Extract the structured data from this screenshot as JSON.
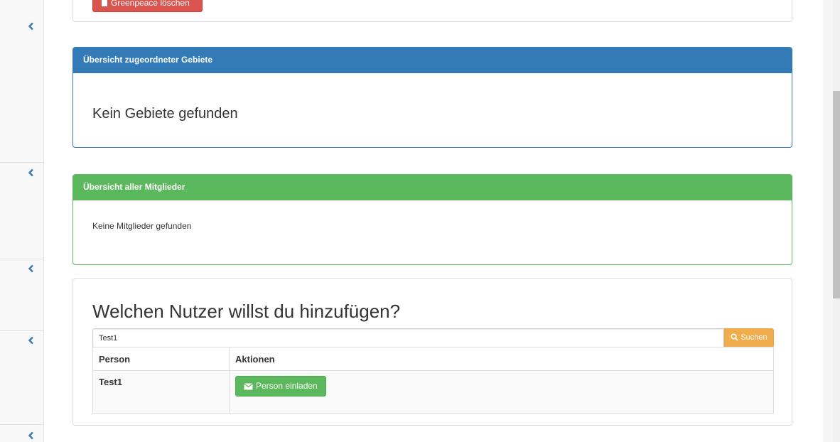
{
  "sidebar": {
    "chevrons": [
      "chevron-left-icon",
      "chevron-left-icon",
      "chevron-left-icon",
      "chevron-left-icon",
      "chevron-left-icon"
    ]
  },
  "greenpeace_panel": {
    "delete_button": "Greenpeace löschen"
  },
  "areas_panel": {
    "heading": "Übersicht zugeordneter Gebiete",
    "empty_text": "Kein Gebiete gefunden"
  },
  "members_panel": {
    "heading": "Übersicht aller Mitglieder",
    "empty_text": "Keine Mitglieder gefunden"
  },
  "add_user_panel": {
    "title": "Welchen Nutzer willst du hinzufügen?",
    "search_value": "Test1",
    "search_button": "Suchen",
    "table": {
      "columns": [
        "Person",
        "Aktionen"
      ],
      "rows": [
        {
          "person": "Test1",
          "action_label": "Person einladen"
        }
      ]
    }
  },
  "colors": {
    "primary": "#337ab7",
    "success": "#5cb85c",
    "warning": "#f0ad4e",
    "danger": "#d9534f"
  }
}
